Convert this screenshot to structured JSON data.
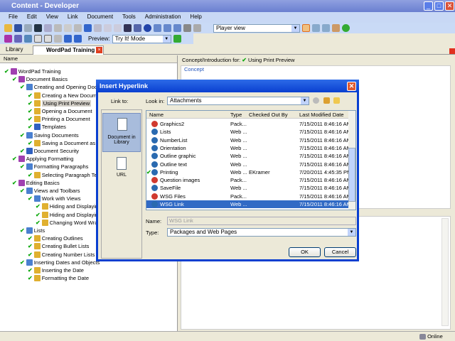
{
  "window": {
    "title": "Content - Developer",
    "min": "_",
    "max": "□",
    "close": "✕"
  },
  "menu": [
    "File",
    "Edit",
    "View",
    "Link",
    "Document",
    "Tools",
    "Administration",
    "Help"
  ],
  "toolbar": {
    "preview_label": "Preview:",
    "preview_mode": "Try It! Mode",
    "view_select": "Player view"
  },
  "tabs": {
    "library": "Library",
    "wordpad": "WordPad Training"
  },
  "tree": {
    "header": "Name",
    "items": [
      {
        "label": "WordPad Training",
        "level": 0,
        "icon": "book"
      },
      {
        "label": "Document Basics",
        "level": 1,
        "icon": "book"
      },
      {
        "label": "Creating and Opening Documents",
        "level": 2,
        "icon": "section"
      },
      {
        "label": "Creating a New Document",
        "level": 3,
        "icon": "topic"
      },
      {
        "label": "Using Print Preview",
        "level": 3,
        "icon": "topic",
        "selected": true
      },
      {
        "label": "Opening a Document",
        "level": 3,
        "icon": "topic"
      },
      {
        "label": "Printing a Document",
        "level": 3,
        "icon": "topic"
      },
      {
        "label": "Templates",
        "level": 3,
        "icon": "doc"
      },
      {
        "label": "Saving Documents",
        "level": 2,
        "icon": "section"
      },
      {
        "label": "Saving a Document as",
        "level": 3,
        "icon": "topic"
      },
      {
        "label": "Document Security",
        "level": 2,
        "icon": "doc"
      },
      {
        "label": "Applying Formatting",
        "level": 1,
        "icon": "book"
      },
      {
        "label": "Formatting Paragraphs",
        "level": 2,
        "icon": "section"
      },
      {
        "label": "Selecting Paragraph Text",
        "level": 3,
        "icon": "topic"
      },
      {
        "label": "Editing Basics",
        "level": 1,
        "icon": "book"
      },
      {
        "label": "Views and Toolbars",
        "level": 2,
        "icon": "section"
      },
      {
        "label": "Work with Views",
        "level": 3,
        "icon": "section"
      },
      {
        "label": "Hiding and Displaying",
        "level": 4,
        "icon": "topic"
      },
      {
        "label": "Hiding and Displaying",
        "level": 4,
        "icon": "topic"
      },
      {
        "label": "Changing Word Wrap",
        "level": 4,
        "icon": "topic"
      },
      {
        "label": "Lists",
        "level": 2,
        "icon": "section"
      },
      {
        "label": "Creating Outlines",
        "level": 3,
        "icon": "topic"
      },
      {
        "label": "Creating Bullet Lists",
        "level": 3,
        "icon": "topic"
      },
      {
        "label": "Creating Number Lists",
        "level": 3,
        "icon": "topic"
      },
      {
        "label": "Inserting Dates and Objects",
        "level": 2,
        "icon": "section"
      },
      {
        "label": "Inserting the Date",
        "level": 3,
        "icon": "topic"
      },
      {
        "label": "Formatting the Date",
        "level": 3,
        "icon": "topic"
      }
    ]
  },
  "right": {
    "concept_for_label": "Concept/Introduction for:",
    "concept_for_value": "Using Print Preview",
    "concept_group": "Concept"
  },
  "dialog": {
    "title": "Insert Hyperlink",
    "link_to": "Link to:",
    "options": [
      {
        "label": "Document in Library",
        "selected": true
      },
      {
        "label": "URL"
      }
    ],
    "look_in_label": "Look in:",
    "look_in_value": "Attachments",
    "columns": [
      "Name",
      "Type",
      "Checked Out By",
      "Last Modified Date"
    ],
    "rows": [
      {
        "name": "Graphics2",
        "type": "Pack...",
        "by": "",
        "date": "7/15/2011 8:46:16 AM",
        "icon": "package"
      },
      {
        "name": "Lists",
        "type": "Web ...",
        "by": "",
        "date": "7/15/2011 8:46:16 AM",
        "icon": "web"
      },
      {
        "name": "NumberList",
        "type": "Web ...",
        "by": "",
        "date": "7/15/2011 8:46:16 AM",
        "icon": "web"
      },
      {
        "name": "Orientation",
        "type": "Web ...",
        "by": "",
        "date": "7/15/2011 8:46:16 AM",
        "icon": "web"
      },
      {
        "name": "Outline graphic",
        "type": "Web ...",
        "by": "",
        "date": "7/15/2011 8:46:16 AM",
        "icon": "web"
      },
      {
        "name": "Outline text",
        "type": "Web ...",
        "by": "",
        "date": "7/15/2011 8:46:16 AM",
        "icon": "web"
      },
      {
        "name": "Printing",
        "type": "Web ...",
        "by": "EKramer",
        "date": "7/20/2011 4:45:35 PM",
        "icon": "web",
        "checked": true
      },
      {
        "name": "Question images",
        "type": "Pack...",
        "by": "",
        "date": "7/15/2011 8:46:16 AM",
        "icon": "package"
      },
      {
        "name": "SaveFile",
        "type": "Web ...",
        "by": "",
        "date": "7/15/2011 8:46:16 AM",
        "icon": "web"
      },
      {
        "name": "WSG Files",
        "type": "Pack...",
        "by": "",
        "date": "7/15/2011 8:46:16 AM",
        "icon": "package"
      },
      {
        "name": "WSG Link",
        "type": "Web ...",
        "by": "",
        "date": "7/15/2011 8:46:16 AM",
        "icon": "web",
        "selected": true
      }
    ],
    "name_label": "Name:",
    "name_value": "WSG Link",
    "type_label": "Type:",
    "type_value": "Packages and Web Pages",
    "ok": "OK",
    "cancel": "Cancel"
  },
  "status": {
    "online": "Online"
  }
}
